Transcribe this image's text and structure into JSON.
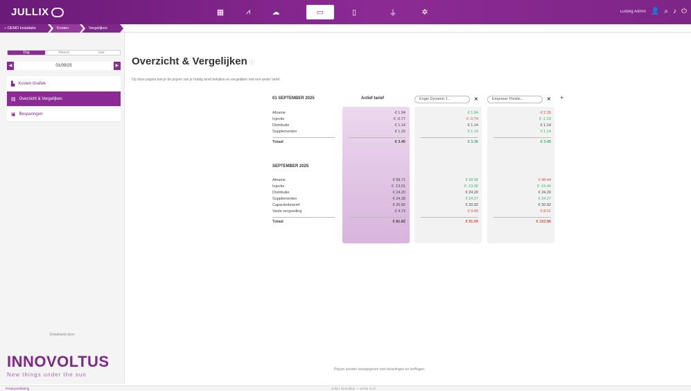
{
  "app": {
    "logo": "JULLIX"
  },
  "nav": {
    "items": [
      {
        "icon": "dashboard-icon",
        "glyph": "▦"
      },
      {
        "icon": "chart-icon",
        "glyph": "⩘"
      },
      {
        "icon": "brain-icon",
        "glyph": "☁"
      },
      {
        "icon": "money-icon",
        "glyph": "▭"
      },
      {
        "icon": "battery-icon",
        "glyph": "▯"
      },
      {
        "icon": "plug-icon",
        "glyph": "⏚"
      },
      {
        "icon": "gear-icon",
        "glyph": "✲"
      }
    ],
    "active_index": 3
  },
  "user": {
    "name": "Ludwig Admin"
  },
  "breadcrumb": [
    {
      "label": "DEMO installatie"
    },
    {
      "label": "Kosten"
    },
    {
      "label": "Vergelijken"
    }
  ],
  "sidebar": {
    "period_tabs": [
      "Dag",
      "Maand",
      "Jaar"
    ],
    "active_period": 0,
    "date": "01/09/25",
    "menu": [
      {
        "label": "Kosten Grafiek",
        "icon": "bar-chart-icon",
        "glyph": "▙"
      },
      {
        "label": "Overzicht & Vergelijken",
        "icon": "compare-icon",
        "glyph": "▤"
      },
      {
        "label": "Besparingen",
        "icon": "savings-icon",
        "glyph": "▣"
      }
    ],
    "active_menu": 1,
    "powered_by": "Ontwikkeld door:",
    "brand": "INNOVOLTUS",
    "tagline": "New things under the sun"
  },
  "main": {
    "title": "Overzicht & Vergelijken",
    "subtitle": "Op deze pagina kan je de prijzen van je huidig tarief bekijken en vergelijken met een ander tarief.",
    "header_active": "Actief tarief",
    "tariffs": [
      "Engie Dynamic f...",
      "Empower Flexibi..."
    ],
    "day": {
      "title": "01 SEPTEMBER 2025",
      "rows": [
        {
          "label": "Afname",
          "a": "€ 1.94",
          "b": "€ 1.84",
          "c": "€ 2.35",
          "bc": "green",
          "cc": "red"
        },
        {
          "label": "Injectie",
          "a": "€ -0.77",
          "b": "€ -0.74",
          "c": "€ -1.10",
          "bc": "red",
          "cc": "green"
        },
        {
          "label": "Distributie",
          "a": "€ 1.14",
          "b": "€ 1.14",
          "c": "€ 1.14",
          "bc": "",
          "cc": ""
        },
        {
          "label": "Supplementen",
          "a": "€ 1.15",
          "b": "€ 1.14",
          "c": "€ 1.14",
          "bc": "green",
          "cc": "green"
        }
      ],
      "total": {
        "label": "Totaal",
        "a": "€ 3.45",
        "b": "€ 3.36",
        "c": "€ 3.45",
        "bc": "green",
        "cc": "green"
      }
    },
    "month": {
      "title": "SEPTEMBER 2025",
      "rows": [
        {
          "label": "Afname",
          "a": "€ 58.71",
          "b": "€ 28.96",
          "c": "€ 48.44",
          "bc": "green",
          "cc": "red"
        },
        {
          "label": "Injectie",
          "a": "€ -13.01",
          "b": "€ -13.06",
          "c": "€ -15.46",
          "bc": "green",
          "cc": "green"
        },
        {
          "label": "Distributie",
          "a": "€ 24.20",
          "b": "€ 24.20",
          "c": "€ 24.20",
          "bc": "",
          "cc": ""
        },
        {
          "label": "Supplementen",
          "a": "€ 24.38",
          "b": "€ 24.27",
          "c": "€ 24.27",
          "bc": "green",
          "cc": "green"
        },
        {
          "label": "Capaciteitstarief",
          "a": "€ 20.92",
          "b": "€ 20.92",
          "c": "€ 20.92",
          "bc": "",
          "cc": ""
        },
        {
          "label": "Vaste vergoeding",
          "a": "€ 4.73",
          "b": "€ 9.80",
          "c": "€ 8.51",
          "bc": "red",
          "cc": "red"
        }
      ],
      "total": {
        "label": "Totaal",
        "a": "€ 81.82",
        "b": "€ 91.09",
        "c": "€ 102.86",
        "bc": "red",
        "cc": "red"
      }
    },
    "footnote": "Prijzen worden weergegeven met belastingen en heffingen."
  },
  "footer": {
    "left": "Privacyverklaring",
    "center": "Jullix | Innovoltus — versie 3.0.0"
  },
  "colors": {
    "primary": "#8c2a94",
    "green": "#3cb371",
    "red": "#e0503a"
  }
}
